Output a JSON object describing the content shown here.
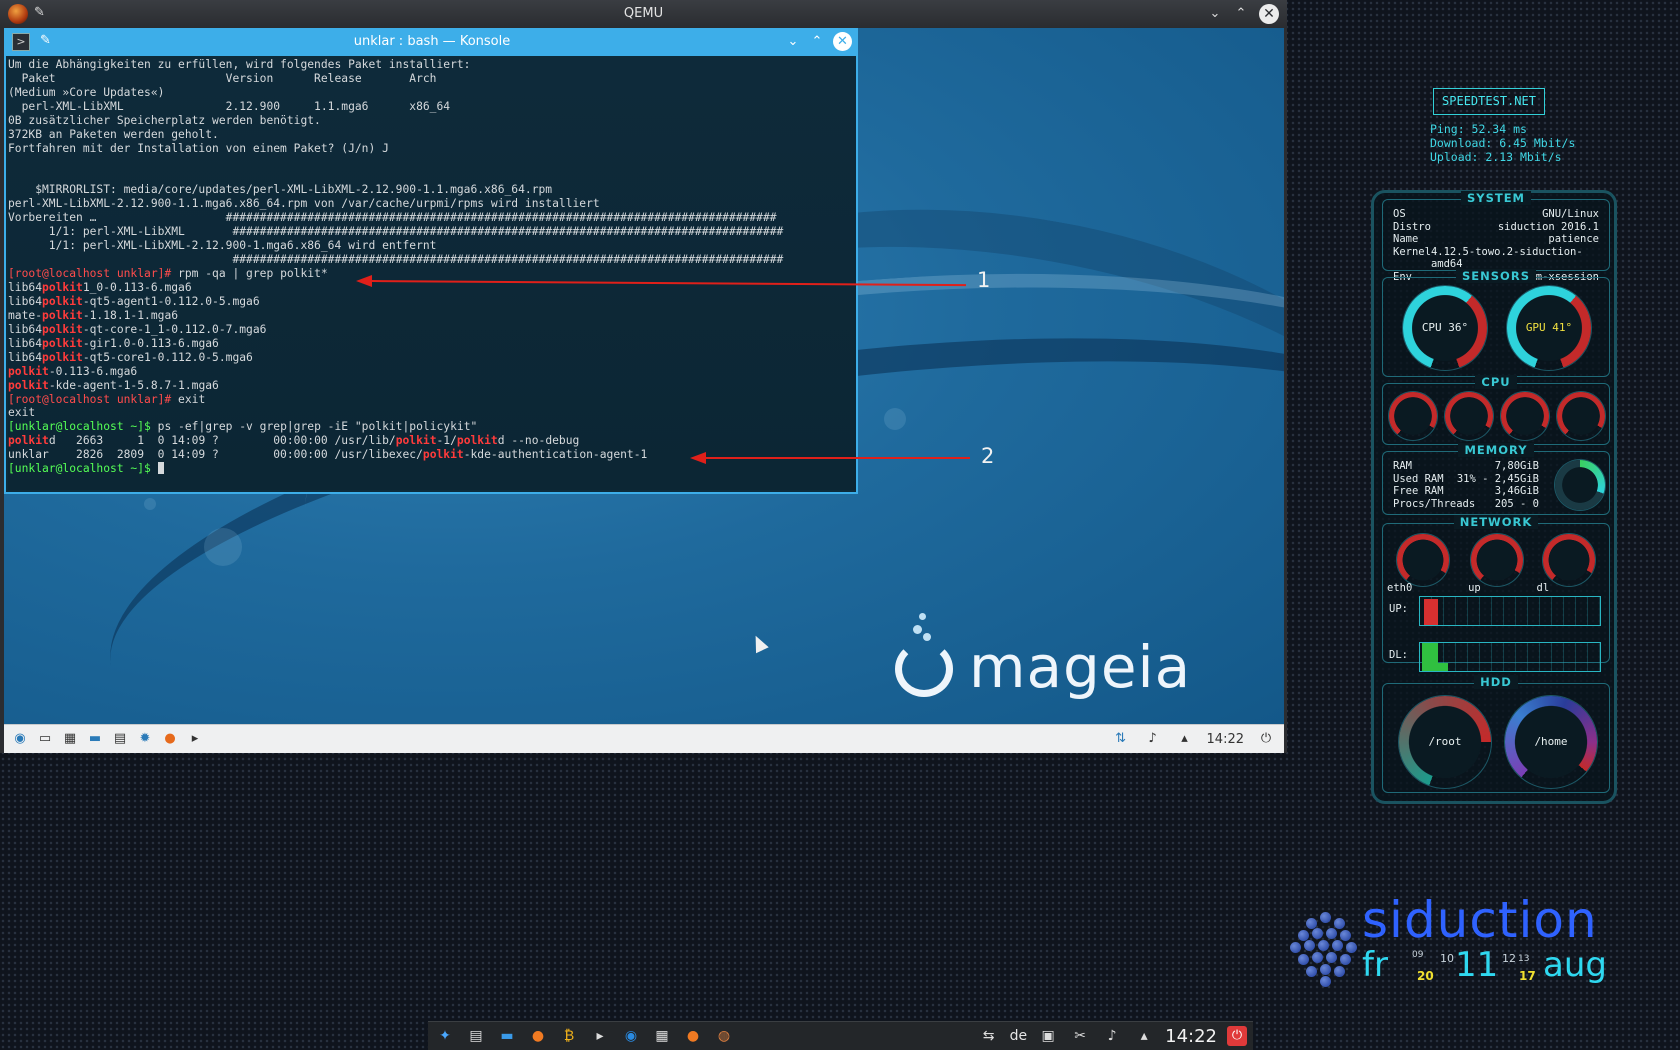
{
  "qemu": {
    "title": "QEMU"
  },
  "konsole": {
    "title": "unklar : bash — Konsole",
    "lines": [
      [
        {
          "t": "Um die Abhängigkeiten zu erfüllen, wird folgendes Paket installiert:",
          "c": ""
        }
      ],
      [
        {
          "t": "  Paket                         Version      Release       Arch",
          "c": ""
        }
      ],
      [
        {
          "t": "(Medium »Core Updates«)",
          "c": ""
        }
      ],
      [
        {
          "t": "  perl-XML-LibXML               2.12.900     1.1.mga6      x86_64",
          "c": ""
        }
      ],
      [
        {
          "t": "0B zusätzlicher Speicherplatz werden benötigt.",
          "c": ""
        }
      ],
      [
        {
          "t": "372KB an Paketen werden geholt.",
          "c": ""
        }
      ],
      [
        {
          "t": "Fortfahren mit der Installation von einem Paket? (J/n) J",
          "c": ""
        }
      ],
      [
        {
          "t": "",
          "c": ""
        }
      ],
      [
        {
          "t": "",
          "c": ""
        }
      ],
      [
        {
          "t": "    $MIRRORLIST: media/core/updates/perl-XML-LibXML-2.12.900-1.1.mga6.x86_64.rpm",
          "c": ""
        }
      ],
      [
        {
          "t": "perl-XML-LibXML-2.12.900-1.1.mga6.x86_64.rpm von /var/cache/urpmi/rpms wird installiert",
          "c": ""
        }
      ],
      [
        {
          "t": "Vorbereiten …                   #################################################################################",
          "c": ""
        }
      ],
      [
        {
          "t": "      1/1: perl-XML-LibXML       #################################################################################",
          "c": ""
        }
      ],
      [
        {
          "t": "      1/1: perl-XML-LibXML-2.12.900-1.mga6.x86_64 wird entfernt",
          "c": ""
        }
      ],
      [
        {
          "t": "                                 #################################################################################",
          "c": ""
        }
      ],
      [
        {
          "t": "[root@localhost unklar]# ",
          "c": "red"
        },
        {
          "t": "rpm -qa | grep polkit*",
          "c": ""
        }
      ],
      [
        {
          "t": "lib64",
          "c": ""
        },
        {
          "t": "polkit",
          "c": "hl"
        },
        {
          "t": "1_0-0.113-6.mga6",
          "c": ""
        }
      ],
      [
        {
          "t": "lib64",
          "c": ""
        },
        {
          "t": "polkit",
          "c": "hl"
        },
        {
          "t": "-qt5-agent1-0.112.0-5.mga6",
          "c": ""
        }
      ],
      [
        {
          "t": "mate-",
          "c": ""
        },
        {
          "t": "polkit",
          "c": "hl"
        },
        {
          "t": "-1.18.1-1.mga6",
          "c": ""
        }
      ],
      [
        {
          "t": "lib64",
          "c": ""
        },
        {
          "t": "polkit",
          "c": "hl"
        },
        {
          "t": "-qt-core-1_1-0.112.0-7.mga6",
          "c": ""
        }
      ],
      [
        {
          "t": "lib64",
          "c": ""
        },
        {
          "t": "polkit",
          "c": "hl"
        },
        {
          "t": "-gir1.0-0.113-6.mga6",
          "c": ""
        }
      ],
      [
        {
          "t": "lib64",
          "c": ""
        },
        {
          "t": "polkit",
          "c": "hl"
        },
        {
          "t": "-qt5-core1-0.112.0-5.mga6",
          "c": ""
        }
      ],
      [
        {
          "t": "polkit",
          "c": "hl"
        },
        {
          "t": "-0.113-6.mga6",
          "c": ""
        }
      ],
      [
        {
          "t": "polkit",
          "c": "hl"
        },
        {
          "t": "-kde-agent-1-5.8.7-1.mga6",
          "c": ""
        }
      ],
      [
        {
          "t": "[root@localhost unklar]# ",
          "c": "red"
        },
        {
          "t": "exit",
          "c": ""
        }
      ],
      [
        {
          "t": "exit",
          "c": ""
        }
      ],
      [
        {
          "t": "[unklar@localhost ~]$ ",
          "c": "grn"
        },
        {
          "t": "ps -ef|grep -v grep|grep -iE \"polkit|policykit\"",
          "c": ""
        }
      ],
      [
        {
          "t": "polkit",
          "c": "hl"
        },
        {
          "t": "d   2663     1  0 14:09 ?        00:00:00 /usr/lib/",
          "c": ""
        },
        {
          "t": "polkit",
          "c": "hl"
        },
        {
          "t": "-1/",
          "c": ""
        },
        {
          "t": "polkit",
          "c": "hl"
        },
        {
          "t": "d --no-debug",
          "c": ""
        }
      ],
      [
        {
          "t": "unklar    2826  2809  0 14:09 ?        00:00:00 /usr/libexec/",
          "c": ""
        },
        {
          "t": "polkit",
          "c": "hl"
        },
        {
          "t": "-kde-authentication-agent-1",
          "c": ""
        }
      ],
      [
        {
          "t": "[unklar@localhost ~]$ ",
          "c": "grn"
        }
      ]
    ]
  },
  "annotations": {
    "one": "1",
    "two": "2"
  },
  "mageia": {
    "wordmark": "mageia"
  },
  "guest_panel": {
    "time": "14:22"
  },
  "speedtest": {
    "button": "SPEEDTEST.NET",
    "ping": "Ping: 52.34 ms",
    "download": "Download: 6.45 Mbit/s",
    "upload": "Upload: 2.13 Mbit/s"
  },
  "conky": {
    "system_title": "SYSTEM",
    "system": [
      {
        "k": "OS",
        "v": "GNU/Linux"
      },
      {
        "k": "Distro",
        "v": "siduction 2016.1"
      },
      {
        "k": "Name",
        "v": "patience"
      },
      {
        "k": "Kernel",
        "v": "4.12.5-towo.2-siduction-amd64"
      },
      {
        "k": " Env",
        "v": "lightdm-xsession"
      }
    ],
    "sensors_title": "SENSORS",
    "cpu_temp": "CPU 36°",
    "gpu_temp": "GPU 41°",
    "cpu_title": "CPU",
    "memory_title": "MEMORY",
    "memory": [
      {
        "k": "RAM",
        "v": "7,80GiB"
      },
      {
        "k": "Used RAM",
        "v": "31% - 2,45GiB"
      },
      {
        "k": "Free RAM",
        "v": "3,46GiB"
      },
      {
        "k": "Procs/Threads",
        "v": "205 - 0"
      }
    ],
    "network_title": "NETWORK",
    "net_eth": "eth0",
    "net_up": "up",
    "net_dl": "dl",
    "graph_up": "UP:",
    "graph_dl": "DL:",
    "hdd_title": "HDD",
    "hdd_root": "/root",
    "hdd_home": "/home"
  },
  "siduction": {
    "brand": "siduction",
    "day": "fr",
    "hour_small_top": "09",
    "hour_small_mid": "10",
    "hour_yel": "20",
    "day_num": "11",
    "min_small_top": "12",
    "min_small_mid": "13",
    "min_yel": "17",
    "month": "aug"
  },
  "host_panel": {
    "lang": "de",
    "time": "14:22"
  }
}
